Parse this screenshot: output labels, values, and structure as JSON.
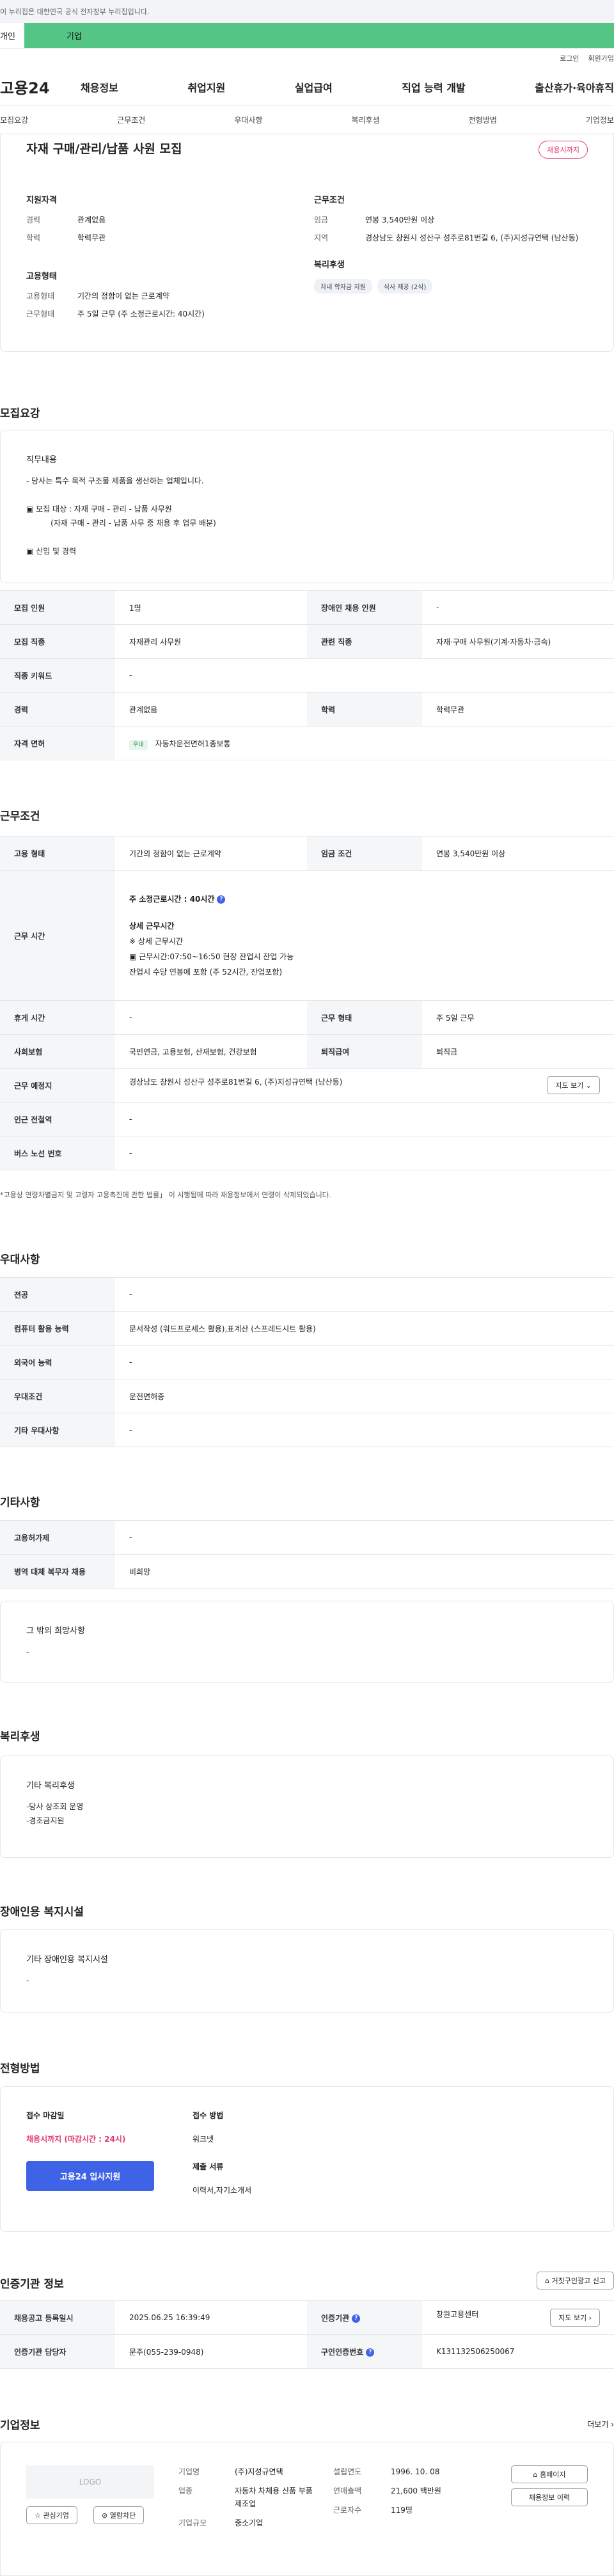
{
  "top_notice": "이 누리집은 대한민국 공식 전자정부 누리집입니다.",
  "tabs": {
    "individual": "개인",
    "corporate": "기업"
  },
  "util": {
    "login": "로그인",
    "signup": "회원가입"
  },
  "site_logo": "고용24",
  "gnb": [
    "채용정보",
    "취업지원",
    "실업급여",
    "직업 능력 개발",
    "출산휴가·육아휴직"
  ],
  "subnav": [
    "모집요강",
    "근무조건",
    "우대사항",
    "복리후생",
    "전형방법",
    "기업정보"
  ],
  "summary": {
    "title": "자재 구매/관리/납품 사원 모집",
    "badge": "채용시까지",
    "qual_title": "지원자격",
    "career_k": "경력",
    "career_v": "관계없음",
    "edu_k": "학력",
    "edu_v": "학력무관",
    "cond_title": "근무조건",
    "wage_k": "임금",
    "wage_v": "연봉 3,540만원 이상",
    "region_k": "지역",
    "region_v": "경상남도 창원시 성산구 성주로81번길 6, (주)지성규연택 (남산동)",
    "emp_title": "고용형태",
    "emp_k": "고용형태",
    "emp_v": "기간의 정함이 없는 근로계약",
    "worktype_k": "근무형태",
    "worktype_v": "주 5일 근무 (주 소정근로시간: 40시간)",
    "welfare_title": "복리후생",
    "welfare_pills": [
      "차내 학자금 지원",
      "식사 제공 (2식)"
    ]
  },
  "recruit": {
    "section": "모집요강",
    "duty_title": "직무내용",
    "duty_lines": [
      "- 당사는 특수 목적 구조물 제품을 생산하는 업체입니다.",
      "",
      "▣ 모집 대상 : 자재 구매 - 관리 - 납품 사무원",
      "          (자재 구매 - 관리 - 납품 사무 중 채용 후 업무 배분)",
      "",
      "▣ 신입 및 경력"
    ],
    "rows": [
      [
        "모집 인원",
        "1명",
        "장애인 채용 인원",
        "-"
      ],
      [
        "모집 직종",
        "자재관리 사무원",
        "관련 직종",
        "자재·구매 사무원(기계·자동차·금속)"
      ],
      [
        "직종 키워드",
        "-",
        "",
        ""
      ],
      [
        "경력",
        "관계없음",
        "학력",
        "학력무관"
      ]
    ],
    "license_k": "자격 면허",
    "license_tag": "우대",
    "license_v": "자동차운전면허1종보통"
  },
  "work": {
    "section": "근무조건",
    "emp_k": "고용 형태",
    "emp_v": "기간의 정함이 없는 근로계약",
    "wagecond_k": "임금 조건",
    "wagecond_v": "연봉 3,540만원 이상",
    "hours_k": "근무 시간",
    "hours_main": "주 소정근로시간 : 40시간",
    "hours_detail_title": "상세 근무시간",
    "hours_lines": [
      "※ 상세 근무시간",
      "▣ 근무시간:07:50~16:50 현장 잔업시 잔업 가능",
      "잔업시 수당 연봉에 포함 (주 52시간, 잔업포함)"
    ],
    "rest_k": "휴게 시간",
    "rest_v": "-",
    "form_k": "근무 형태",
    "form_v": "주 5일 근무",
    "ins_k": "사회보험",
    "ins_v": "국민연금, 고용보험, 산재보험, 건강보험",
    "sev_k": "퇴직급여",
    "sev_v": "퇴직금",
    "loc_k": "근무 예정지",
    "loc_v": "경상남도 창원시 성산구 성주로81번길 6, (주)지성규연택 (남산동)",
    "map_btn": "지도 보기",
    "subway_k": "인근 전철역",
    "subway_v": "-",
    "bus_k": "버스 노선 번호",
    "bus_v": "-",
    "note": "*고용상 연령차별금지 및 고령자 고용촉진에 관한 법률」 이 시행됨에 따라 채용정보에서 연령이 삭제되었습니다."
  },
  "pref": {
    "section": "우대사항",
    "rows": [
      [
        "전공",
        "-"
      ],
      [
        "컴퓨터 활용 능력",
        "문서작성 (워드프로세스 활용),표계산 (스프레드시트 활용)"
      ],
      [
        "외국어 능력",
        "-"
      ],
      [
        "우대조건",
        "운전면허증"
      ],
      [
        "기타 우대사항",
        "-"
      ]
    ]
  },
  "etc": {
    "section": "기타사항",
    "rows": [
      [
        "고용허가제",
        "-"
      ],
      [
        "병역 대체 복무자 채용",
        "비희망"
      ]
    ],
    "wish_title": "그 밖의 희망사항",
    "wish_v": "-"
  },
  "welfare": {
    "section": "복리후생",
    "title": "기타 복리후생",
    "lines": [
      "-당사 상조회 운영",
      "-경조금지원"
    ]
  },
  "disabled": {
    "section": "장애인용 복지시설",
    "title": "기타 장애인용 복지시설",
    "v": "-"
  },
  "process": {
    "section": "전형방법",
    "deadline_k": "접수 마감일",
    "deadline_v": "채용시까지 (마감시간 : 24시)",
    "apply_btn": "고용24 입사지원",
    "method_k": "접수 방법",
    "method_v": "워크넷",
    "docs_k": "제출 서류",
    "docs_v": "이력서,자기소개서"
  },
  "agency": {
    "section": "인증기관 정보",
    "report_btn": "거짓구인광고 신고",
    "reg_k": "채용공고 등록일시",
    "reg_v": "2025.06.25 16:39:49",
    "org_k": "인증기관",
    "org_v": "창원고용센터",
    "map_btn": "지도 보기",
    "staff_k": "인증기관 담당자",
    "staff_v": "문주(055-239-0948)",
    "no_k": "구인인증번호",
    "no_v": "K131132506250067"
  },
  "company": {
    "section": "기업정보",
    "more": "더보기",
    "logo": "LOGO",
    "fav_btn": "관심기업",
    "block_btn": "열람차단",
    "name_k": "기업명",
    "name_v": "(주)지성규연택",
    "ind_k": "업종",
    "ind_v": "자동차 차체용 신품 부품 제조업",
    "size_k": "기업규모",
    "size_v": "중소기업",
    "year_k": "설립연도",
    "year_v": "1996. 10. 08",
    "sales_k": "연매출액",
    "sales_v": "21,600 백만원",
    "emp_k": "근로자수",
    "emp_v": "119명",
    "home_btn": "홈페이지",
    "hist_btn": "채용정보 이력"
  }
}
